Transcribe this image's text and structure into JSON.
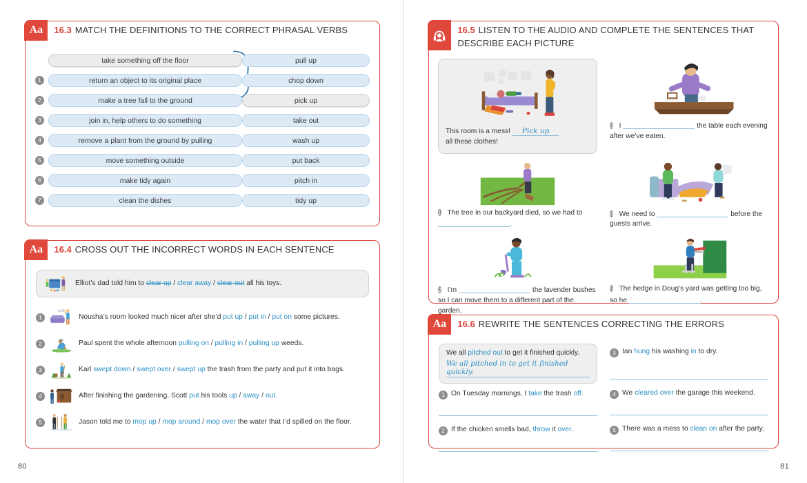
{
  "pages": {
    "left_number": "80",
    "right_number": "81"
  },
  "ex163": {
    "icon": "aa-icon",
    "tab_label": "Aa",
    "number": "16.3",
    "title": "MATCH THE DEFINITIONS TO THE CORRECT PHRASAL VERBS",
    "definitions": [
      {
        "marker": "",
        "text": "take something off the floor",
        "sample": true
      },
      {
        "marker": "1",
        "text": "return an object to its original place",
        "sample": false
      },
      {
        "marker": "2",
        "text": "make a tree fall to the ground",
        "sample": false
      },
      {
        "marker": "3",
        "text": "join in, help others to do something",
        "sample": false
      },
      {
        "marker": "4",
        "text": "remove a plant from the ground by pulling",
        "sample": false
      },
      {
        "marker": "5",
        "text": "move something outside",
        "sample": false
      },
      {
        "marker": "6",
        "text": "make tidy again",
        "sample": false
      },
      {
        "marker": "7",
        "text": "clean the dishes",
        "sample": false
      }
    ],
    "verbs": [
      {
        "text": "pull up",
        "sample": false
      },
      {
        "text": "chop down",
        "sample": false
      },
      {
        "text": "pick up",
        "sample": true
      },
      {
        "text": "take out",
        "sample": false
      },
      {
        "text": "wash up",
        "sample": false
      },
      {
        "text": "put back",
        "sample": false
      },
      {
        "text": "pitch in",
        "sample": false
      },
      {
        "text": "tidy up",
        "sample": false
      }
    ],
    "answer_link": "take something off the floor → pick up"
  },
  "ex164": {
    "tab_label": "Aa",
    "number": "16.4",
    "title": "CROSS OUT THE INCORRECT WORDS IN EACH SENTENCE",
    "sample": {
      "image": "boy-and-dad-tidying-toys-illustration",
      "pre": "Elliot’s dad told him to ",
      "opt1": "clear up",
      "opt2": "clear away",
      "opt3": "clear out",
      "post": " all his toys.",
      "crossed": [
        "clear up",
        "clear out"
      ]
    },
    "items": [
      {
        "marker": "1",
        "image": "woman-hanging-pictures-over-sofa-illustration",
        "pre": "Nousha’s room looked much nicer after she’d ",
        "opt1": "put up",
        "opt2": "put in",
        "opt3": "put on",
        "post": " some pictures."
      },
      {
        "marker": "2",
        "image": "man-weeding-garden-illustration",
        "pre": "Paul spent the whole afternoon ",
        "opt1": "pulling on",
        "opt2": "pulling in",
        "opt3": "pulling up",
        "post": " weeds."
      },
      {
        "marker": "3",
        "image": "man-sweeping-trash-outdoors-illustration",
        "pre": "Karl ",
        "opt1": "swept down",
        "opt2": "swept over",
        "opt3": "swept up",
        "post": " the trash from the party and put it into bags."
      },
      {
        "marker": "4",
        "image": "man-at-garden-shed-illustration",
        "pre": "After finishing the gardening, Scott ",
        "mid": "put",
        "mid_post": " his tools ",
        "opt1": "up",
        "opt2": "away",
        "opt3": "out",
        "post": "."
      },
      {
        "marker": "5",
        "image": "two-people-mopping-floor-illustration",
        "pre": "Jason told me to ",
        "opt1": "mop up",
        "opt2": "mop around",
        "opt3": "mop over",
        "post": " the water that I’d spilled on the floor."
      }
    ]
  },
  "ex165": {
    "icon": "headphones-audio-icon",
    "number": "16.5",
    "title": "LISTEN TO THE AUDIO AND COMPLETE THE SENTENCES THAT DESCRIBE EACH PICTURE",
    "sample": {
      "image": "messy-bedroom-mother-and-children-illustration",
      "pre": "This room is a mess!",
      "answer": "Pick up",
      "post": "all these clothes!"
    },
    "items": [
      {
        "marker": "3",
        "image": "man-clearing-table-illustration",
        "pre": "I",
        "post": "the table each evening after we’ve eaten.",
        "blank_first": false
      },
      {
        "marker": "1",
        "image": "dead-tree-in-backyard-illustration",
        "pre": "The tree in our backyard died, so we had to",
        "post": ".",
        "blank_first": false
      },
      {
        "marker": "4",
        "image": "people-tidying-messy-living-room-illustration",
        "pre": "We need to",
        "post": "before the guests arrive.",
        "blank_first": false
      },
      {
        "marker": "2",
        "image": "person-digging-lavender-bushes-illustration",
        "pre": "I’m",
        "post": "the lavender bushes so I can move them to a different part of the garden.",
        "blank_first": false
      },
      {
        "marker": "5",
        "image": "man-trimming-hedge-illustration",
        "pre": "The hedge in Doug’s yard was getting too big, so he",
        "post": ".",
        "blank_first": false
      }
    ]
  },
  "ex166": {
    "tab_label": "Aa",
    "number": "16.6",
    "title": "REWRITE THE SENTENCES CORRECTING THE ERRORS",
    "sample": {
      "pre": "We all ",
      "err": "pitched out",
      "post": " to get it finished quickly.",
      "answer": "We all pitched in to get it finished quickly."
    },
    "items": [
      {
        "marker": "1",
        "parts": [
          {
            "t": "On Tuesday mornings, I ",
            "c": "dark"
          },
          {
            "t": "take",
            "c": "blue"
          },
          {
            "t": " the trash ",
            "c": "dark"
          },
          {
            "t": "off",
            "c": "blue"
          },
          {
            "t": ".",
            "c": "dark"
          }
        ]
      },
      {
        "marker": "2",
        "parts": [
          {
            "t": "If the chicken smells bad, ",
            "c": "dark"
          },
          {
            "t": "throw",
            "c": "blue"
          },
          {
            "t": " it ",
            "c": "dark"
          },
          {
            "t": "over",
            "c": "blue"
          },
          {
            "t": ".",
            "c": "dark"
          }
        ]
      },
      {
        "marker": "3",
        "parts": [
          {
            "t": "Ian ",
            "c": "dark"
          },
          {
            "t": "hung",
            "c": "blue"
          },
          {
            "t": " his washing ",
            "c": "dark"
          },
          {
            "t": "in",
            "c": "blue"
          },
          {
            "t": " to dry.",
            "c": "dark"
          }
        ]
      },
      {
        "marker": "4",
        "parts": [
          {
            "t": "We ",
            "c": "dark"
          },
          {
            "t": "cleared over",
            "c": "blue"
          },
          {
            "t": " the garage this weekend.",
            "c": "dark"
          }
        ]
      },
      {
        "marker": "5",
        "parts": [
          {
            "t": "There was a mess to ",
            "c": "dark"
          },
          {
            "t": "clean on",
            "c": "blue"
          },
          {
            "t": " after the party.",
            "c": "dark"
          }
        ]
      }
    ]
  },
  "colors": {
    "accent_red": "#d9453c",
    "tab_red": "#e1483c",
    "pill_blue": "#ddeaf6",
    "pill_border": "#b8d4ea",
    "link_blue": "#2b8fc4",
    "sample_gray": "#efefef"
  }
}
